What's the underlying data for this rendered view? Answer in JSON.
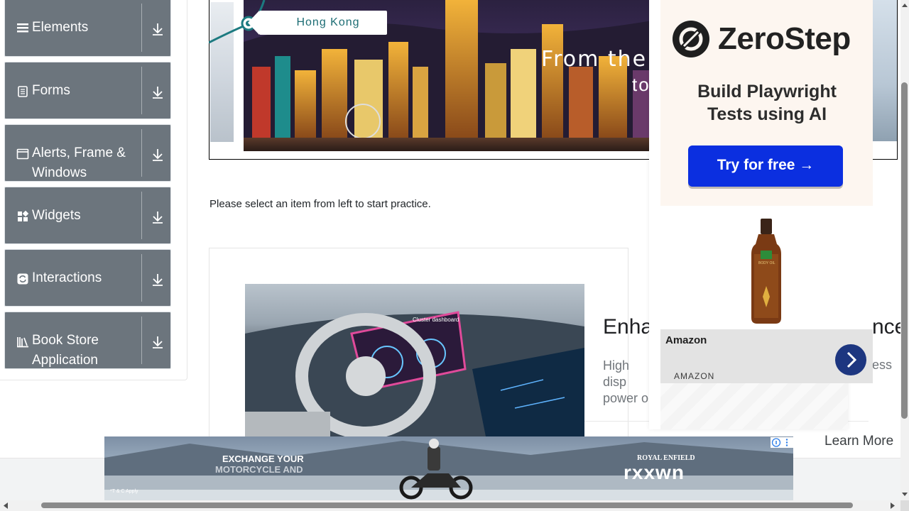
{
  "sidebar": {
    "groups": [
      {
        "label": "Elements",
        "icon": "bars-icon"
      },
      {
        "label": "Forms",
        "icon": "document-icon"
      },
      {
        "label": "Alerts, Frame & Windows",
        "icon": "window-icon"
      },
      {
        "label": "Widgets",
        "icon": "widgets-icon"
      },
      {
        "label": "Interactions",
        "icon": "sync-icon"
      },
      {
        "label": "Book Store Application",
        "icon": "books-icon"
      }
    ]
  },
  "banner": {
    "tag": "Hong Kong",
    "headline_line1": "From the V",
    "headline_line2": "to"
  },
  "main": {
    "practice_text": "Please select an item from left to start practice."
  },
  "article": {
    "title_start": "Enha",
    "title_end": "nce",
    "desc_start": "High disp power o",
    "desc_end": "ess",
    "image_label": "Cluster dashboard"
  },
  "side_ad": {
    "brand": "ZeroStep",
    "tagline": "Build Playwright Tests using AI",
    "cta": "Try for free →",
    "seller_title": "Amazon",
    "seller_sub": "AMAZON",
    "product_label": "BODY OIL"
  },
  "bottom_ad": {
    "headline_1": "EXCHANGE YOUR",
    "headline_2": "MOTORCYCLE AND",
    "brand_small": "ROYAL ENFIELD",
    "brand_big": "rxxwn",
    "fine_print": "*T & C Apply",
    "learn_more": "Learn More"
  },
  "colors": {
    "sidebar_bg": "#6c757d",
    "cta_blue": "#0b2fe0",
    "amazon_arrow": "#1d3680",
    "tag_text": "#1d6d74"
  }
}
